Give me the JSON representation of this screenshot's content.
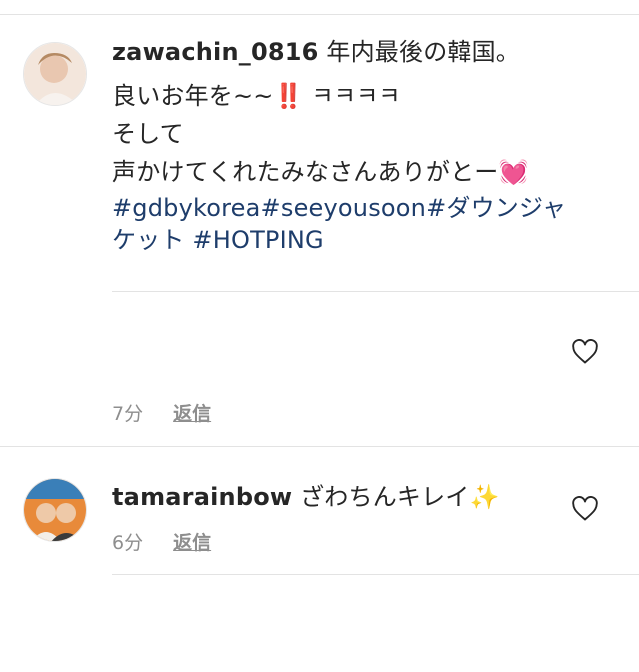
{
  "comments": [
    {
      "username": "zawachin_0816",
      "lines": [
        " 年内最後の韓国。",
        "良いお年を~~‼️ ㅋㅋㅋㅋ",
        "そして",
        "声かけてくれたみなさんありがとー💓"
      ],
      "hashtags_line1": "#gdbykorea#seeyousoon#ダウンジャ",
      "hashtags_line2": "ケット #HOTPING",
      "time": "7分",
      "reply_label": "返信"
    },
    {
      "username": "tamarainbow",
      "text": " ざわちんキレイ✨",
      "time": "6分",
      "reply_label": "返信"
    }
  ]
}
